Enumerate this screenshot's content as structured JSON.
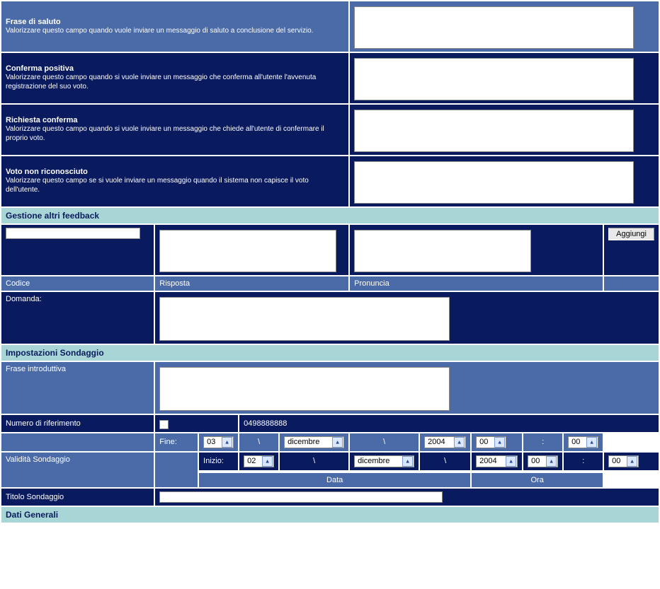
{
  "sections": {
    "dati_generali": "Dati Generali",
    "impostazioni": "Impostazioni Sondaggio",
    "gestione_feedback": "Gestione altri feedback"
  },
  "form": {
    "titolo_label": "Titolo Sondaggio",
    "titolo_value": "",
    "validita_label": "Validità Sondaggio",
    "data_header": "Data",
    "ora_header": "Ora",
    "inizio_label": "Inizio:",
    "fine_label": "Fine:",
    "inizio": {
      "day": "02",
      "month": "dicembre",
      "year": "2004",
      "hour": "00",
      "min": "00"
    },
    "fine": {
      "day": "03",
      "month": "dicembre",
      "year": "2004",
      "hour": "00",
      "min": "00"
    },
    "slash": "\\",
    "colon": ":",
    "numero_label": "Numero di riferimento",
    "numero_value": "0498888888",
    "frase_intro_label": "Frase introduttiva",
    "frase_intro_value": "",
    "domanda_label": "Domanda:",
    "domanda_value": "",
    "col_codice": "Codice",
    "col_risposta": "Risposta",
    "col_pronuncia": "Pronuncia",
    "codice_value": "",
    "risposta_value": "",
    "pronuncia_value": "",
    "aggiungi_label": "Aggiungi",
    "fb1_title": "Voto non riconosciuto",
    "fb1_desc": "Valorizzare questo campo se si vuole inviare un messaggio quando il sistema non capisce il voto dell'utente.",
    "fb2_title": "Richiesta conferma",
    "fb2_desc": "Valorizzare questo campo quando si vuole inviare un messaggio che chiede all'utente di confermare il proprio voto.",
    "fb3_title": "Conferma positiva",
    "fb3_desc": "Valorizzare questo campo quando si vuole inviare un messaggio che conferma all'utente l'avvenuta registrazione del suo voto.",
    "fb4_title": "Frase di saluto",
    "fb4_desc": "Valorizzare questo campo quando vuole inviare un messaggio di saluto a conclusione del servizio."
  }
}
